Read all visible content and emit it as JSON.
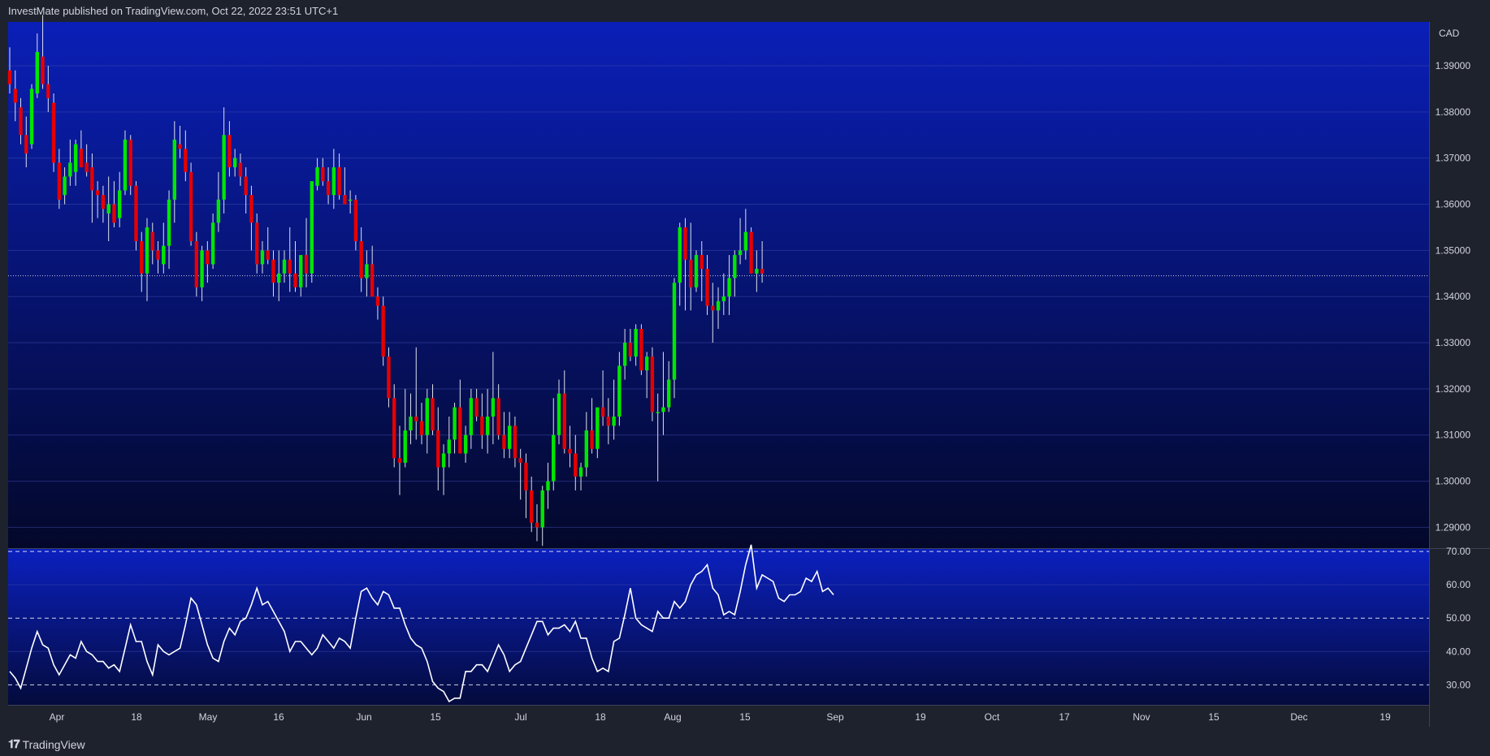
{
  "header": {
    "text": "InvestMate published on TradingView.com, Oct 22, 2022 23:51 UTC+1"
  },
  "footer": {
    "logo_mark": "𝟏𝟕",
    "logo_text": "TradingView"
  },
  "chart_data": [
    {
      "type": "candlestick",
      "currency_label": "CAD",
      "y_ticks": [
        "1.39000",
        "1.38000",
        "1.37000",
        "1.36000",
        "1.35000",
        "1.34000",
        "1.33000",
        "1.32000",
        "1.31000",
        "1.30000",
        "1.29000"
      ],
      "ylim": [
        1.2855,
        1.3995
      ],
      "last_price": 1.3445,
      "x_labels": [
        "Apr",
        "18",
        "May",
        "16",
        "Jun",
        "15",
        "Jul",
        "18",
        "Aug",
        "15",
        "Sep",
        "19",
        "Oct",
        "17",
        "Nov",
        "15",
        "Dec",
        "19"
      ],
      "up_color": "#00e600",
      "down_color": "#e60000",
      "candles": [
        [
          1.389,
          1.394,
          1.384,
          1.386
        ],
        [
          1.385,
          1.389,
          1.378,
          1.382
        ],
        [
          1.381,
          1.383,
          1.373,
          1.375
        ],
        [
          1.375,
          1.379,
          1.368,
          1.371
        ],
        [
          1.373,
          1.386,
          1.372,
          1.385
        ],
        [
          1.384,
          1.397,
          1.383,
          1.393
        ],
        [
          1.392,
          1.401,
          1.385,
          1.386
        ],
        [
          1.386,
          1.39,
          1.38,
          1.383
        ],
        [
          1.382,
          1.384,
          1.367,
          1.369
        ],
        [
          1.369,
          1.372,
          1.359,
          1.361
        ],
        [
          1.362,
          1.368,
          1.36,
          1.366
        ],
        [
          1.366,
          1.374,
          1.364,
          1.369
        ],
        [
          1.367,
          1.374,
          1.364,
          1.373
        ],
        [
          1.372,
          1.376,
          1.368,
          1.368
        ],
        [
          1.369,
          1.373,
          1.366,
          1.367
        ],
        [
          1.368,
          1.371,
          1.356,
          1.363
        ],
        [
          1.363,
          1.365,
          1.357,
          1.362
        ],
        [
          1.362,
          1.364,
          1.356,
          1.359
        ],
        [
          1.358,
          1.366,
          1.352,
          1.36
        ],
        [
          1.36,
          1.365,
          1.355,
          1.356
        ],
        [
          1.357,
          1.367,
          1.355,
          1.363
        ],
        [
          1.363,
          1.376,
          1.362,
          1.374
        ],
        [
          1.374,
          1.375,
          1.362,
          1.364
        ],
        [
          1.364,
          1.365,
          1.35,
          1.352
        ],
        [
          1.352,
          1.354,
          1.341,
          1.345
        ],
        [
          1.345,
          1.357,
          1.339,
          1.355
        ],
        [
          1.354,
          1.356,
          1.347,
          1.35
        ],
        [
          1.35,
          1.352,
          1.345,
          1.348
        ],
        [
          1.347,
          1.356,
          1.345,
          1.351
        ],
        [
          1.351,
          1.363,
          1.346,
          1.361
        ],
        [
          1.361,
          1.378,
          1.356,
          1.374
        ],
        [
          1.373,
          1.377,
          1.37,
          1.372
        ],
        [
          1.372,
          1.376,
          1.365,
          1.367
        ],
        [
          1.367,
          1.369,
          1.351,
          1.352
        ],
        [
          1.352,
          1.354,
          1.34,
          1.342
        ],
        [
          1.342,
          1.351,
          1.339,
          1.35
        ],
        [
          1.35,
          1.352,
          1.343,
          1.347
        ],
        [
          1.347,
          1.358,
          1.346,
          1.356
        ],
        [
          1.356,
          1.367,
          1.354,
          1.361
        ],
        [
          1.361,
          1.381,
          1.358,
          1.375
        ],
        [
          1.375,
          1.378,
          1.366,
          1.368
        ],
        [
          1.368,
          1.372,
          1.366,
          1.37
        ],
        [
          1.369,
          1.371,
          1.364,
          1.366
        ],
        [
          1.366,
          1.368,
          1.358,
          1.362
        ],
        [
          1.362,
          1.364,
          1.35,
          1.356
        ],
        [
          1.356,
          1.358,
          1.345,
          1.347
        ],
        [
          1.347,
          1.352,
          1.345,
          1.35
        ],
        [
          1.35,
          1.355,
          1.347,
          1.348
        ],
        [
          1.348,
          1.35,
          1.34,
          1.343
        ],
        [
          1.343,
          1.35,
          1.339,
          1.345
        ],
        [
          1.345,
          1.35,
          1.343,
          1.348
        ],
        [
          1.348,
          1.355,
          1.341,
          1.345
        ],
        [
          1.345,
          1.352,
          1.341,
          1.342
        ],
        [
          1.342,
          1.347,
          1.34,
          1.349
        ],
        [
          1.349,
          1.357,
          1.342,
          1.345
        ],
        [
          1.345,
          1.365,
          1.343,
          1.365
        ],
        [
          1.364,
          1.37,
          1.363,
          1.368
        ],
        [
          1.368,
          1.37,
          1.364,
          1.365
        ],
        [
          1.365,
          1.368,
          1.36,
          1.362
        ],
        [
          1.362,
          1.372,
          1.359,
          1.368
        ],
        [
          1.368,
          1.371,
          1.361,
          1.362
        ],
        [
          1.362,
          1.368,
          1.36,
          1.36
        ],
        [
          1.361,
          1.363,
          1.358,
          1.361
        ],
        [
          1.361,
          1.362,
          1.35,
          1.352
        ],
        [
          1.352,
          1.355,
          1.341,
          1.344
        ],
        [
          1.344,
          1.35,
          1.34,
          1.347
        ],
        [
          1.347,
          1.351,
          1.341,
          1.34
        ],
        [
          1.34,
          1.342,
          1.335,
          1.338
        ],
        [
          1.338,
          1.34,
          1.325,
          1.327
        ],
        [
          1.327,
          1.329,
          1.316,
          1.318
        ],
        [
          1.318,
          1.321,
          1.303,
          1.305
        ],
        [
          1.305,
          1.312,
          1.297,
          1.304
        ],
        [
          1.304,
          1.32,
          1.303,
          1.311
        ],
        [
          1.311,
          1.319,
          1.308,
          1.314
        ],
        [
          1.314,
          1.329,
          1.309,
          1.313
        ],
        [
          1.313,
          1.317,
          1.308,
          1.31
        ],
        [
          1.31,
          1.32,
          1.306,
          1.318
        ],
        [
          1.318,
          1.321,
          1.31,
          1.311
        ],
        [
          1.311,
          1.316,
          1.298,
          1.303
        ],
        [
          1.303,
          1.308,
          1.297,
          1.306
        ],
        [
          1.306,
          1.314,
          1.303,
          1.309
        ],
        [
          1.309,
          1.317,
          1.306,
          1.316
        ],
        [
          1.316,
          1.322,
          1.309,
          1.306
        ],
        [
          1.306,
          1.312,
          1.304,
          1.31
        ],
        [
          1.31,
          1.32,
          1.307,
          1.318
        ],
        [
          1.318,
          1.32,
          1.313,
          1.314
        ],
        [
          1.314,
          1.319,
          1.307,
          1.31
        ],
        [
          1.31,
          1.32,
          1.306,
          1.314
        ],
        [
          1.314,
          1.328,
          1.308,
          1.318
        ],
        [
          1.318,
          1.321,
          1.309,
          1.31
        ],
        [
          1.31,
          1.315,
          1.305,
          1.307
        ],
        [
          1.307,
          1.315,
          1.305,
          1.312
        ],
        [
          1.312,
          1.314,
          1.303,
          1.305
        ],
        [
          1.305,
          1.307,
          1.296,
          1.304
        ],
        [
          1.304,
          1.306,
          1.292,
          1.298
        ],
        [
          1.298,
          1.301,
          1.289,
          1.291
        ],
        [
          1.291,
          1.295,
          1.287,
          1.29
        ],
        [
          1.29,
          1.299,
          1.286,
          1.298
        ],
        [
          1.298,
          1.304,
          1.294,
          1.3
        ],
        [
          1.3,
          1.318,
          1.298,
          1.31
        ],
        [
          1.31,
          1.322,
          1.308,
          1.319
        ],
        [
          1.319,
          1.324,
          1.306,
          1.307
        ],
        [
          1.307,
          1.312,
          1.303,
          1.306
        ],
        [
          1.306,
          1.31,
          1.298,
          1.301
        ],
        [
          1.301,
          1.304,
          1.298,
          1.303
        ],
        [
          1.303,
          1.315,
          1.301,
          1.311
        ],
        [
          1.311,
          1.318,
          1.306,
          1.307
        ],
        [
          1.307,
          1.313,
          1.305,
          1.316
        ],
        [
          1.316,
          1.324,
          1.312,
          1.314
        ],
        [
          1.314,
          1.318,
          1.308,
          1.312
        ],
        [
          1.312,
          1.322,
          1.309,
          1.314
        ],
        [
          1.314,
          1.328,
          1.312,
          1.325
        ],
        [
          1.325,
          1.333,
          1.322,
          1.33
        ],
        [
          1.33,
          1.333,
          1.326,
          1.327
        ],
        [
          1.327,
          1.334,
          1.325,
          1.333
        ],
        [
          1.333,
          1.334,
          1.323,
          1.324
        ],
        [
          1.324,
          1.328,
          1.318,
          1.327
        ],
        [
          1.327,
          1.329,
          1.313,
          1.315
        ],
        [
          1.315,
          1.319,
          1.3,
          1.315
        ],
        [
          1.315,
          1.328,
          1.31,
          1.316
        ],
        [
          1.316,
          1.326,
          1.315,
          1.322
        ],
        [
          1.322,
          1.344,
          1.318,
          1.343
        ],
        [
          1.343,
          1.356,
          1.338,
          1.355
        ],
        [
          1.355,
          1.357,
          1.337,
          1.348
        ],
        [
          1.348,
          1.356,
          1.337,
          1.342
        ],
        [
          1.342,
          1.35,
          1.341,
          1.349
        ],
        [
          1.349,
          1.352,
          1.339,
          1.346
        ],
        [
          1.346,
          1.349,
          1.336,
          1.338
        ],
        [
          1.338,
          1.343,
          1.33,
          1.337
        ],
        [
          1.337,
          1.342,
          1.333,
          1.339
        ],
        [
          1.339,
          1.345,
          1.336,
          1.34
        ],
        [
          1.34,
          1.349,
          1.336,
          1.344
        ],
        [
          1.344,
          1.35,
          1.34,
          1.349
        ],
        [
          1.349,
          1.357,
          1.347,
          1.35
        ],
        [
          1.35,
          1.359,
          1.348,
          1.354
        ],
        [
          1.354,
          1.355,
          1.345,
          1.345
        ],
        [
          1.345,
          1.35,
          1.341,
          1.346
        ],
        [
          1.346,
          1.352,
          1.343,
          1.345
        ]
      ]
    },
    {
      "type": "line",
      "y_ticks": [
        "70.00",
        "60.00",
        "50.00",
        "40.00",
        "30.00"
      ],
      "ylim": [
        24,
        71
      ],
      "level_lines": [
        70,
        50,
        30
      ],
      "series": [
        {
          "values": [
            34,
            32,
            29,
            35,
            41,
            46,
            42,
            41,
            36,
            33,
            36,
            39,
            38,
            43,
            40,
            39,
            37,
            37,
            35,
            36,
            34,
            41,
            48,
            43,
            43,
            37,
            33,
            42,
            40,
            39,
            40,
            41,
            48,
            56,
            54,
            48,
            42,
            38,
            37,
            43,
            47,
            45,
            49,
            50,
            54,
            59,
            54,
            55,
            52,
            49,
            46,
            40,
            43,
            43,
            41,
            39,
            41,
            45,
            43,
            41,
            44,
            43,
            41,
            50,
            58,
            59,
            56,
            54,
            58,
            57,
            53,
            53,
            48,
            44,
            42,
            41,
            37,
            31,
            29,
            28,
            25,
            26,
            26,
            34,
            34,
            36,
            36,
            34,
            38,
            42,
            39,
            34,
            36,
            37,
            41,
            45,
            49,
            49,
            45,
            47,
            47,
            48,
            46,
            49,
            44,
            44,
            38,
            34,
            35,
            34,
            43,
            44,
            51,
            59,
            50,
            48,
            47,
            46,
            52,
            50,
            50,
            55,
            53,
            55,
            60,
            63,
            64,
            66,
            59,
            57,
            51,
            52,
            51,
            58,
            66,
            72,
            59,
            63,
            62,
            61,
            56,
            55,
            57,
            57,
            58,
            62,
            61,
            64,
            58,
            59,
            57
          ]
        }
      ]
    }
  ]
}
